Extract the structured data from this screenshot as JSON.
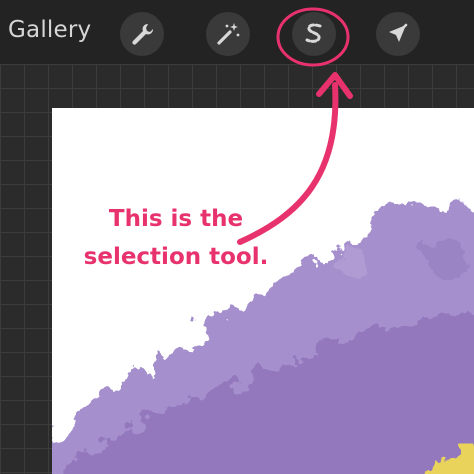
{
  "toolbar": {
    "gallery_label": "Gallery",
    "tools": [
      {
        "name": "actions",
        "icon": "wrench-icon"
      },
      {
        "name": "adjustments",
        "icon": "magic-wand-icon"
      },
      {
        "name": "selection",
        "icon": "selection-s-icon"
      },
      {
        "name": "transform",
        "icon": "arrow-cursor-icon"
      }
    ]
  },
  "annotation": {
    "line1": "This is the",
    "line2": "selection tool.",
    "color": "#e8326e"
  },
  "canvas": {
    "paint_colors": [
      "#9b84c4",
      "#e9d35a"
    ]
  }
}
